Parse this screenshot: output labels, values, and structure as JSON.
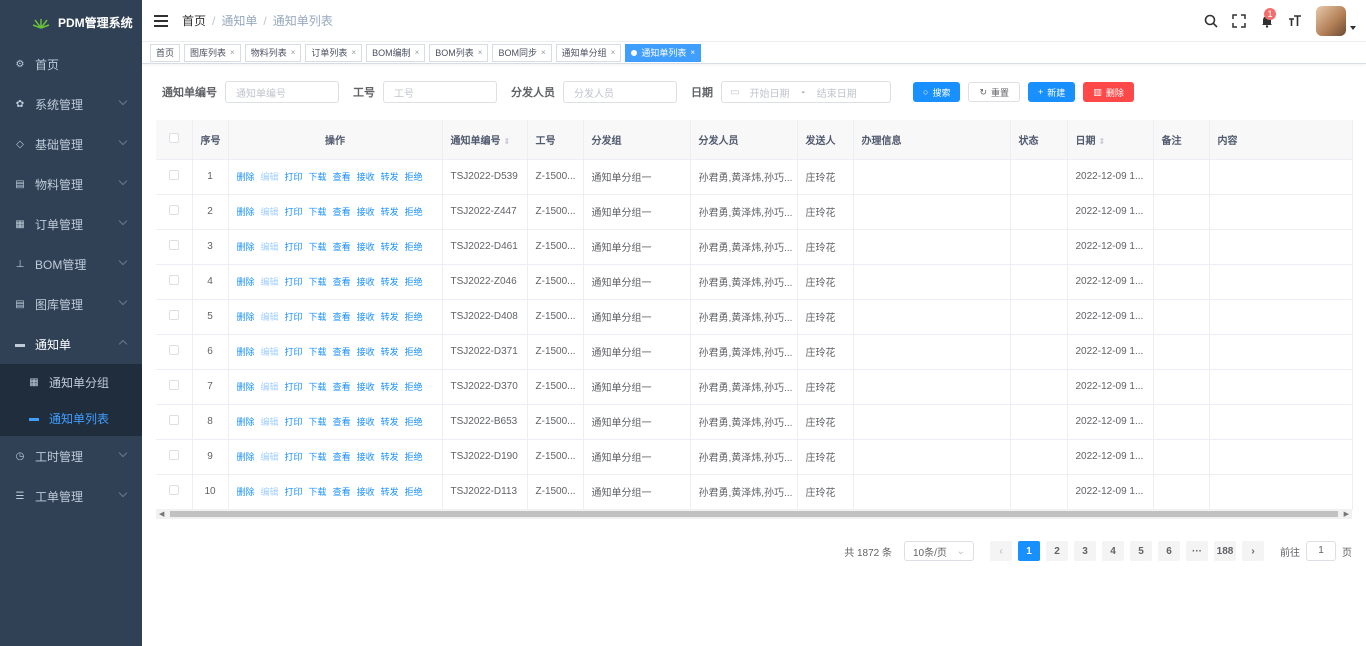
{
  "app": {
    "title": "PDM管理系统"
  },
  "sidebar": {
    "items": [
      {
        "label": "首页",
        "icon": "dashboard-icon"
      },
      {
        "label": "系统管理",
        "icon": "gear-icon"
      },
      {
        "label": "基础管理",
        "icon": "shield-icon"
      },
      {
        "label": "物料管理",
        "icon": "document-icon"
      },
      {
        "label": "订单管理",
        "icon": "grid-icon"
      },
      {
        "label": "BOM管理",
        "icon": "tree-icon"
      },
      {
        "label": "图库管理",
        "icon": "document-icon"
      },
      {
        "label": "通知单",
        "icon": "message-icon"
      },
      {
        "label": "工时管理",
        "icon": "clock-icon"
      },
      {
        "label": "工单管理",
        "icon": "form-icon"
      }
    ],
    "submenu": [
      {
        "label": "通知单分组"
      },
      {
        "label": "通知单列表"
      }
    ]
  },
  "navbar": {
    "breadcrumb": [
      "首页",
      "通知单",
      "通知单列表"
    ],
    "badge_count": "1"
  },
  "tags": [
    "首页",
    "图库列表",
    "物料列表",
    "订单列表",
    "BOM编制",
    "BOM列表",
    "BOM同步",
    "通知单分组",
    "通知单列表"
  ],
  "search": {
    "no_label": "通知单编号",
    "no_placeholder": "通知单编号",
    "work_label": "工号",
    "work_placeholder": "工号",
    "distributor_label": "分发人员",
    "distributor_placeholder": "分发人员",
    "date_label": "日期",
    "start_placeholder": "开始日期",
    "date_sep": "-",
    "end_placeholder": "结束日期",
    "search_btn": "搜索",
    "reset_btn": "重置",
    "add_btn": "新建",
    "delete_btn": "删除"
  },
  "table": {
    "headers": {
      "index": "序号",
      "ops": "操作",
      "no": "通知单编号",
      "work": "工号",
      "group": "分发组",
      "people": "分发人员",
      "sender": "发送人",
      "info": "办理信息",
      "status": "状态",
      "date": "日期",
      "remark": "备注",
      "content": "内容"
    },
    "ops": [
      "删除",
      "编辑",
      "打印",
      "下载",
      "查看",
      "接收",
      "转发",
      "拒绝"
    ],
    "rows": [
      {
        "idx": "1",
        "no": "TSJ2022-D539",
        "work": "Z-1500...",
        "group": "通知单分组一",
        "people": "孙君勇,黄泽炜,孙巧...",
        "sender": "庄玲花",
        "date": "2022-12-09 1..."
      },
      {
        "idx": "2",
        "no": "TSJ2022-Z447",
        "work": "Z-1500...",
        "group": "通知单分组一",
        "people": "孙君勇,黄泽炜,孙巧...",
        "sender": "庄玲花",
        "date": "2022-12-09 1..."
      },
      {
        "idx": "3",
        "no": "TSJ2022-D461",
        "work": "Z-1500...",
        "group": "通知单分组一",
        "people": "孙君勇,黄泽炜,孙巧...",
        "sender": "庄玲花",
        "date": "2022-12-09 1..."
      },
      {
        "idx": "4",
        "no": "TSJ2022-Z046",
        "work": "Z-1500...",
        "group": "通知单分组一",
        "people": "孙君勇,黄泽炜,孙巧...",
        "sender": "庄玲花",
        "date": "2022-12-09 1..."
      },
      {
        "idx": "5",
        "no": "TSJ2022-D408",
        "work": "Z-1500...",
        "group": "通知单分组一",
        "people": "孙君勇,黄泽炜,孙巧...",
        "sender": "庄玲花",
        "date": "2022-12-09 1..."
      },
      {
        "idx": "6",
        "no": "TSJ2022-D371",
        "work": "Z-1500...",
        "group": "通知单分组一",
        "people": "孙君勇,黄泽炜,孙巧...",
        "sender": "庄玲花",
        "date": "2022-12-09 1..."
      },
      {
        "idx": "7",
        "no": "TSJ2022-D370",
        "work": "Z-1500...",
        "group": "通知单分组一",
        "people": "孙君勇,黄泽炜,孙巧...",
        "sender": "庄玲花",
        "date": "2022-12-09 1..."
      },
      {
        "idx": "8",
        "no": "TSJ2022-B653",
        "work": "Z-1500...",
        "group": "通知单分组一",
        "people": "孙君勇,黄泽炜,孙巧...",
        "sender": "庄玲花",
        "date": "2022-12-09 1..."
      },
      {
        "idx": "9",
        "no": "TSJ2022-D190",
        "work": "Z-1500...",
        "group": "通知单分组一",
        "people": "孙君勇,黄泽炜,孙巧...",
        "sender": "庄玲花",
        "date": "2022-12-09 1..."
      },
      {
        "idx": "10",
        "no": "TSJ2022-D113",
        "work": "Z-1500...",
        "group": "通知单分组一",
        "people": "孙君勇,黄泽炜,孙巧...",
        "sender": "庄玲花",
        "date": "2022-12-09 1..."
      }
    ]
  },
  "pagination": {
    "total": "共 1872 条",
    "page_size": "10条/页",
    "pages": [
      "1",
      "2",
      "3",
      "4",
      "5",
      "6",
      "···",
      "188"
    ],
    "goto_label": "前往",
    "goto_value": "1",
    "page_unit": "页"
  },
  "colors": {
    "primary": "#1890ff",
    "danger": "#ff4949",
    "sidebar": "#304156"
  }
}
